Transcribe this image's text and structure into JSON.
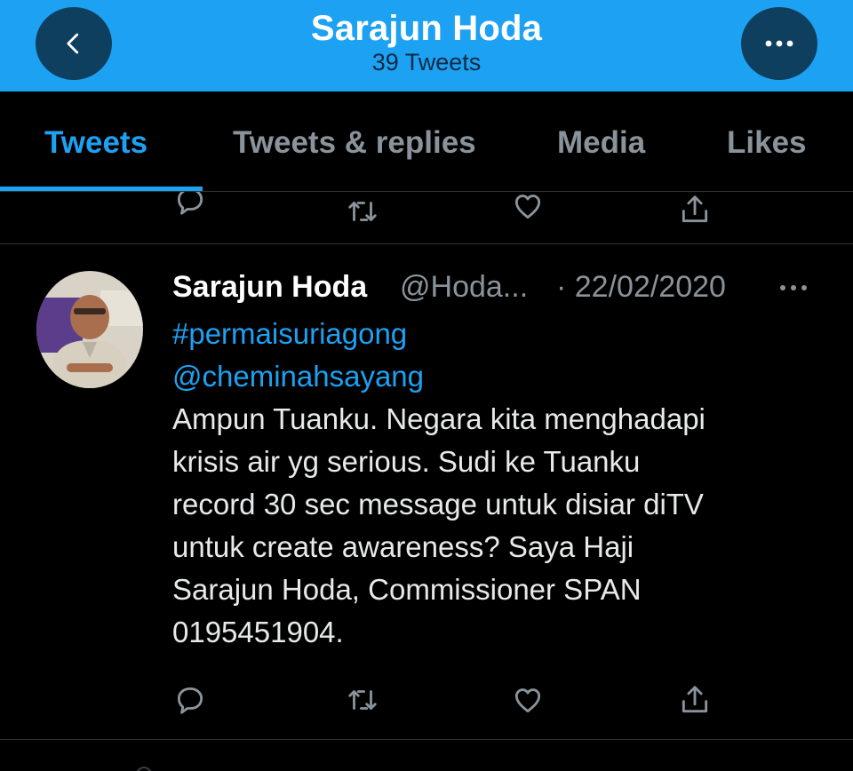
{
  "header": {
    "title": "Sarajun Hoda",
    "subtitle": "39 Tweets",
    "back_icon": "chevron-left-icon",
    "more_icon": "more-horizontal-icon"
  },
  "tabs": [
    {
      "label": "Tweets",
      "active": true
    },
    {
      "label": "Tweets & replies",
      "active": false
    },
    {
      "label": "Media",
      "active": false
    },
    {
      "label": "Likes",
      "active": false
    }
  ],
  "tweet": {
    "author_name": "Sarajun Hoda",
    "handle": "@Hoda...",
    "date": "· 22/02/2020",
    "hashtag": "#permaisuriagong",
    "mention": "@cheminahsayang",
    "lines": [
      "Ampun Tuanku. Negara kita menghadapi",
      "krisis air yg serious. Sudi ke Tuanku",
      "record 30 sec message untuk disiar diTV",
      "untuk create awareness? Saya Haji",
      "Sarajun Hoda, Commissioner SPAN",
      "0195451904."
    ],
    "actions": [
      "reply-icon",
      "retweet-icon",
      "like-icon",
      "share-icon"
    ]
  },
  "colors": {
    "accent": "#1da1f2",
    "background": "#000000",
    "muted_text": "#8a939b",
    "header_button": "#0f3f5f"
  }
}
